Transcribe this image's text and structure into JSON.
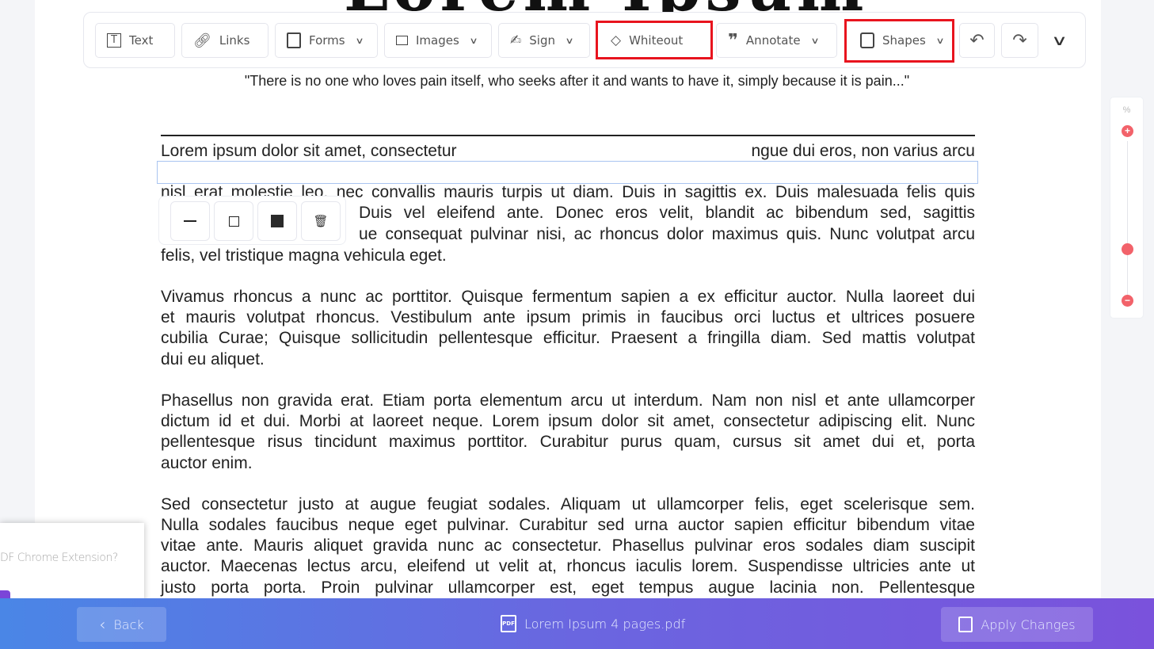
{
  "document": {
    "title": "Lorem Ipsum",
    "quote": "\"There is no one who loves pain itself, who seeks after it and wants to have it, simply because it is pain...\"",
    "line1_left": "Lorem ipsum dolor sit amet, consectetur",
    "line1_right": "ngue dui eros, non varius arcu",
    "line2": "nisl erat molestie leo, nec convallis mauris turpis ut diam. Duis in sagittis ex. Duis malesuada felis quis",
    "line3_visible": "Duis vel eleifend ante. Donec eros velit, blandit ac bibendum sed, sagittis",
    "line4_visible": "ue consequat pulvinar nisi, ac rhoncus dolor maximus quis. Nunc volutpat arcu",
    "line5": "felis, vel tristique magna vehicula eget.",
    "p2": [
      "Vivamus rhoncus a nunc ac porttitor. Quisque fermentum sapien a ex efficitur auctor. Nulla laoreet dui",
      "et mauris volutpat rhoncus. Vestibulum ante ipsum primis in faucibus orci luctus et ultrices posuere",
      "cubilia Curae; Quisque sollicitudin pellentesque efficitur. Praesent a fringilla diam. Sed mattis volutpat",
      "dui eu aliquet."
    ],
    "p3": [
      "Phasellus non gravida erat. Etiam porta elementum arcu ut interdum. Nam non nisl et ante ullamcorper",
      "dictum id et dui. Morbi at laoreet neque. Lorem ipsum dolor sit amet, consectetur adipiscing elit. Nunc",
      "pellentesque risus tincidunt maximus porttitor. Curabitur purus quam, cursus sit amet dui et, porta",
      "auctor enim."
    ],
    "p4": [
      "Sed consectetur justo at augue feugiat sodales. Aliquam ut ullamcorper felis, eget scelerisque sem.",
      "Nulla sodales faucibus neque eget pulvinar. Curabitur sed urna auctor sapien efficitur bibendum vitae",
      "vitae ante. Mauris aliquet gravida nunc ac consectetur. Phasellus pulvinar eros sodales diam suscipit",
      "auctor. Maecenas lectus arcu, eleifend ut velit at, rhoncus iaculis lorem. Suspendisse ultricies ante ut",
      "justo porta porta. Proin pulvinar ullamcorper est, eget tempus augue lacinia non. Pellentesque"
    ]
  },
  "toolbar": {
    "text": "Text",
    "links": "Links",
    "forms": "Forms",
    "images": "Images",
    "sign": "Sign",
    "whiteout": "Whiteout",
    "annotate": "Annotate",
    "shapes": "Shapes",
    "highlight_color": "#e8141e"
  },
  "zoom": {
    "label": "%",
    "level_percent": 18
  },
  "promo": {
    "text": "DF Chrome Extension?"
  },
  "bottom": {
    "back": "Back",
    "filename": "Lorem Ipsum 4 pages.pdf",
    "pdf_badge": "PDF",
    "apply": "Apply Changes"
  }
}
